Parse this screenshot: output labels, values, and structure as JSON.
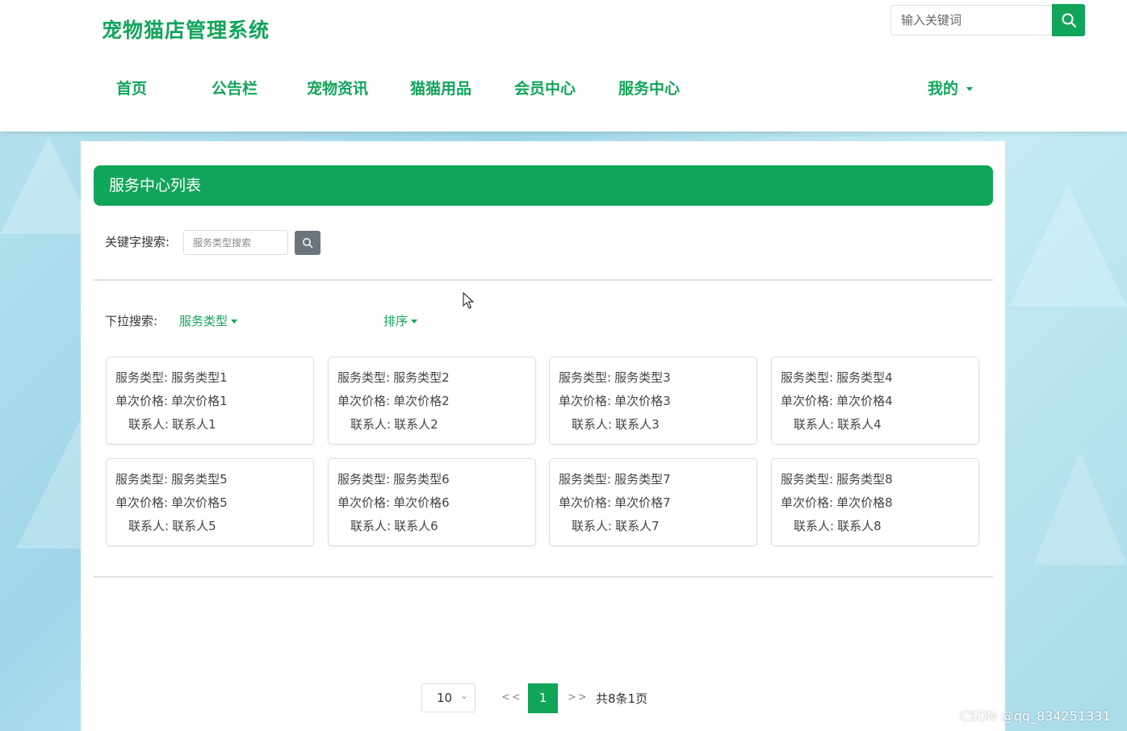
{
  "header": {
    "site_title": "宠物猫店管理系统",
    "search_placeholder": "输入关键词",
    "nav": [
      {
        "label": "首页"
      },
      {
        "label": "公告栏"
      },
      {
        "label": "宠物资讯"
      },
      {
        "label": "猫猫用品"
      },
      {
        "label": "会员中心"
      },
      {
        "label": "服务中心"
      }
    ],
    "user_menu": "我的",
    "accent_color": "#11a55a"
  },
  "main": {
    "title": "服务中心列表",
    "keyword_label": "关键字搜索:",
    "keyword_placeholder": "服务类型搜索",
    "dropdown_label": "下拉搜索:",
    "dropdown_type": "服务类型",
    "dropdown_sort": "排序",
    "cards": [
      {
        "type_label": "服务类型:",
        "type": "服务类型1",
        "price_label": "单次价格:",
        "price": "单次价格1",
        "contact_label": "联系人:",
        "contact": "联系人1"
      },
      {
        "type_label": "服务类型:",
        "type": "服务类型2",
        "price_label": "单次价格:",
        "price": "单次价格2",
        "contact_label": "联系人:",
        "contact": "联系人2"
      },
      {
        "type_label": "服务类型:",
        "type": "服务类型3",
        "price_label": "单次价格:",
        "price": "单次价格3",
        "contact_label": "联系人:",
        "contact": "联系人3"
      },
      {
        "type_label": "服务类型:",
        "type": "服务类型4",
        "price_label": "单次价格:",
        "price": "单次价格4",
        "contact_label": "联系人:",
        "contact": "联系人4"
      },
      {
        "type_label": "服务类型:",
        "type": "服务类型5",
        "price_label": "单次价格:",
        "price": "单次价格5",
        "contact_label": "联系人:",
        "contact": "联系人5"
      },
      {
        "type_label": "服务类型:",
        "type": "服务类型6",
        "price_label": "单次价格:",
        "price": "单次价格6",
        "contact_label": "联系人:",
        "contact": "联系人6"
      },
      {
        "type_label": "服务类型:",
        "type": "服务类型7",
        "price_label": "单次价格:",
        "price": "单次价格7",
        "contact_label": "联系人:",
        "contact": "联系人7"
      },
      {
        "type_label": "服务类型:",
        "type": "服务类型8",
        "price_label": "单次价格:",
        "price": "单次价格8",
        "contact_label": "联系人:",
        "contact": "联系人8"
      }
    ],
    "pagination": {
      "page_size": "10",
      "prev": "<<",
      "current": "1",
      "next": ">>",
      "total_text": "共8条1页"
    }
  },
  "watermark": "CSDN @qq_834251331"
}
